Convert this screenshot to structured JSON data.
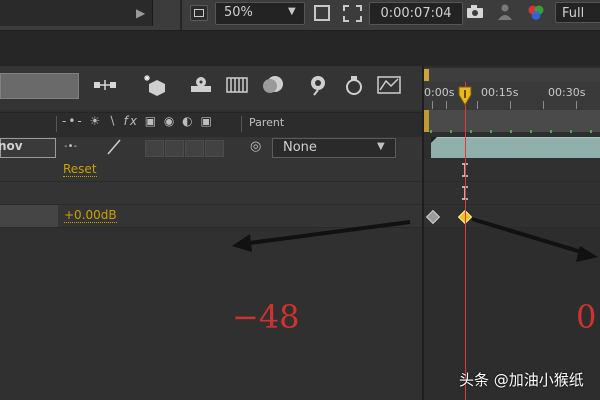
{
  "viewer_toolbar": {
    "zoom": "50%",
    "timecode": "0:00:07:04",
    "resolution": "Full"
  },
  "layer": {
    "name_fragment": "nov",
    "parent_label": "Parent",
    "parent_value": "None"
  },
  "properties": {
    "reset_label": "Reset",
    "volume_value": "+0.00dB"
  },
  "timeline": {
    "ticks": [
      "0:00s",
      "00:15s",
      "00:30s"
    ]
  },
  "annotations": {
    "left_value": "−48",
    "right_value": "0"
  },
  "watermark": {
    "text": "头条 @加油小猴纸"
  },
  "colors": {
    "annotation": "#d0322f",
    "keyframe_active": "#f0c020",
    "property_value": "#c9a200",
    "playhead": "#e03a3a"
  },
  "icons": {
    "toolbar": [
      "monitor-icon",
      "zoom-dropdown",
      "region-of-interest-icon",
      "transparency-grid-icon",
      "snapshot-camera-icon",
      "show-snapshot-icon",
      "channel-icon",
      "resolution-dropdown"
    ],
    "comp_toolbar": [
      "composition-flowchart-icon",
      "draft-3d-icon",
      "hide-shy-layers-icon",
      "frame-blending-icon",
      "motion-blur-icon",
      "brainstorm-icon",
      "graph-editor-icon"
    ]
  }
}
